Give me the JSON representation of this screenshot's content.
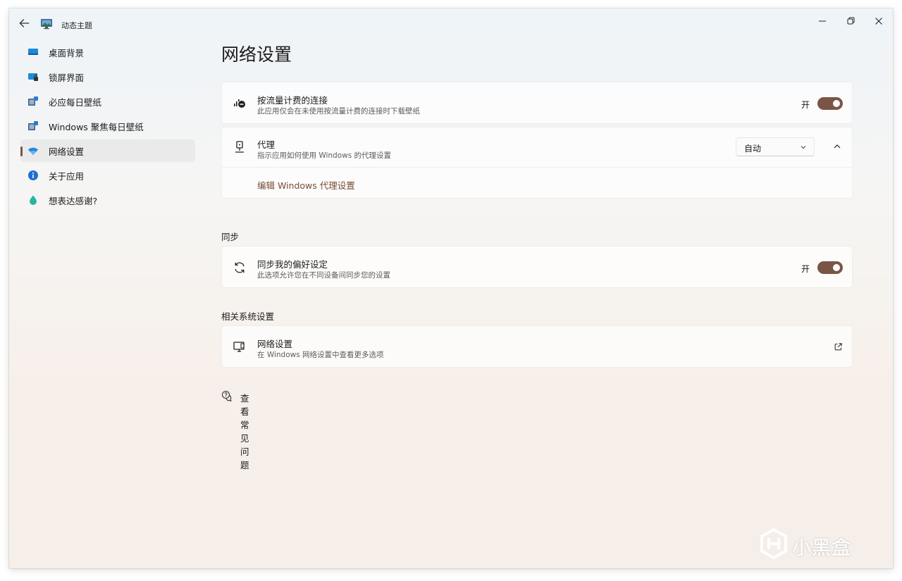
{
  "window": {
    "title": "动态主题"
  },
  "sidebar": {
    "items": [
      {
        "label": "桌面背景",
        "icon": "desktop-icon",
        "selected": false
      },
      {
        "label": "锁屏界面",
        "icon": "lockscreen-icon",
        "selected": false
      },
      {
        "label": "必应每日壁纸",
        "icon": "bing-wallpaper-icon",
        "selected": false
      },
      {
        "label": "Windows 聚焦每日壁纸",
        "icon": "spotlight-wallpaper-icon",
        "selected": false
      },
      {
        "label": "网络设置",
        "icon": "network-icon",
        "selected": true
      },
      {
        "label": "关于应用",
        "icon": "info-icon",
        "selected": false
      },
      {
        "label": "想表达感谢?",
        "icon": "thanks-icon",
        "selected": false
      }
    ]
  },
  "main": {
    "page_title": "网络设置",
    "metered": {
      "title": "按流量计费的连接",
      "desc": "此应用仅会在未使用按流量计费的连接时下载壁纸",
      "toggle_label": "开",
      "toggle_on": true
    },
    "proxy": {
      "title": "代理",
      "desc": "指示应用如何使用 Windows 的代理设置",
      "dropdown_value": "自动",
      "edit_link": "编辑 Windows 代理设置",
      "expanded": true
    },
    "sync_section": {
      "header": "同步",
      "title": "同步我的偏好设定",
      "desc": "此选项允许您在不同设备间同步您的设置",
      "toggle_label": "开",
      "toggle_on": true
    },
    "related_section": {
      "header": "相关系统设置",
      "title": "网络设置",
      "desc": "在 Windows 网络设置中查看更多选项"
    },
    "help": {
      "label": "查看常见问题"
    }
  },
  "watermark": {
    "text": "小黑盒"
  },
  "colors": {
    "accent": "#7a5546",
    "link": "#7a4a33"
  }
}
